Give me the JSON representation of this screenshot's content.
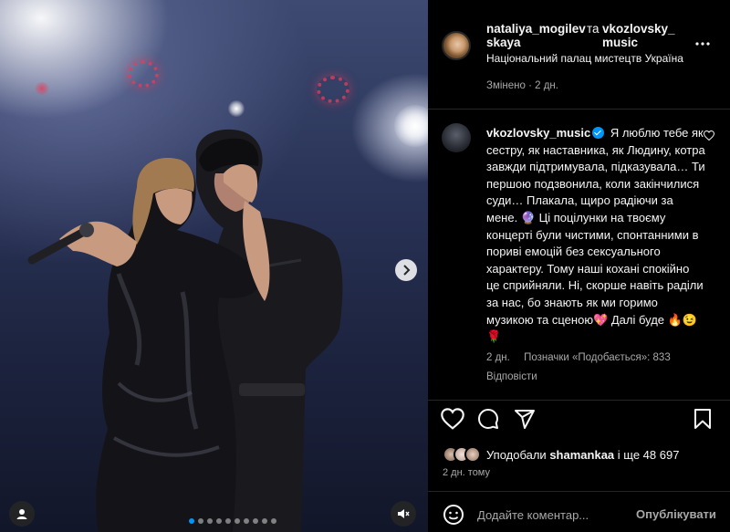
{
  "post": {
    "author_1": "nataliya_mogilevskaya",
    "author_1_line1": "nataliya_mogilev",
    "author_1_line2": "skaya",
    "joiner": "та",
    "author_2_line1": "vkozlovsky_",
    "author_2_line2": "music",
    "location": "Національний палац мистецтв Україна",
    "edited": "Змінено · 2 дн."
  },
  "caption": {
    "username": "vkozlovsky_music",
    "text": "Я люблю тебе як сестру, як наставника, як Людину, котра завжди підтримувала, підказувала… Ти першою подзвонила, коли закінчилися суди… Плакала, щиро радіючи за мене. 🔮 Ці поцілунки на твоєму концерті були чистими, спонтанними в пориві емоцій без сексуального характеру. Тому наші кохані спокійно це сприйняли. Ні, скорше навіть раділи за нас, бо знають як ми горимо музикою та сценою💖 Далі буде 🔥😉🌹",
    "age": "2 дн.",
    "likes_info": "Позначки «Подобається»: 833",
    "reply": "Відповісти"
  },
  "likes": {
    "prefix": "Уподобали",
    "user": "shamankaa",
    "suffix": "і ще 48 697"
  },
  "date": "2 дн. тому",
  "comment": {
    "placeholder": "Додайте коментар...",
    "publish": "Опублікувати"
  },
  "icons": {
    "like": "heart-icon",
    "comment": "comment-icon",
    "share": "send-icon",
    "save": "bookmark-icon",
    "more": "more-icon",
    "emoji": "emoji-icon",
    "next": "chevron-right-icon",
    "tags": "user-tag-icon",
    "mute": "mute-icon"
  },
  "carousel": {
    "count": 10,
    "active": 1
  },
  "colors": {
    "accent": "#0095f6",
    "bg": "#000000",
    "text": "#f5f5f5",
    "muted": "#a8a8a8"
  }
}
